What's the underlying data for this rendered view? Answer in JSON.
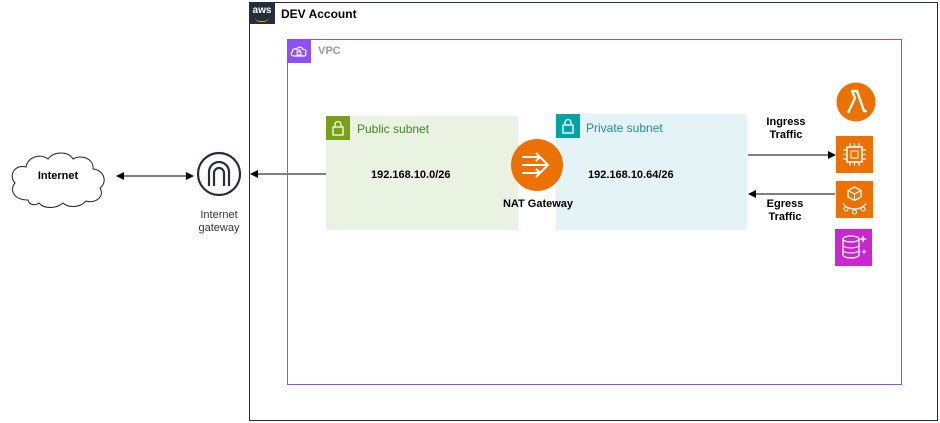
{
  "account": {
    "title": "DEV Account",
    "badge": "aws"
  },
  "vpc": {
    "label": "VPC"
  },
  "internet": {
    "label": "Internet"
  },
  "internet_gateway": {
    "label_line1": "Internet",
    "label_line2": "gateway"
  },
  "public_subnet": {
    "label": "Public subnet",
    "cidr": "192.168.10.0/26"
  },
  "nat_gateway": {
    "label": "NAT Gateway"
  },
  "private_subnet": {
    "label": "Private subnet",
    "cidr": "192.168.10.64/26"
  },
  "traffic": {
    "ingress_line1": "Ingress",
    "ingress_line2": "Traffic",
    "egress_line1": "Egress",
    "egress_line2": "Traffic"
  },
  "services": [
    {
      "icon": "lambda-icon",
      "color": "#ed7100"
    },
    {
      "icon": "ec2-icon",
      "color": "#ed7100"
    },
    {
      "icon": "ecs-icon",
      "color": "#ed7100"
    },
    {
      "icon": "database-icon",
      "color": "#c925d1"
    }
  ],
  "colors": {
    "vpc": "#8c4fff",
    "public": "#7aa116",
    "private": "#00a4a6",
    "nat": "#ed7100"
  }
}
